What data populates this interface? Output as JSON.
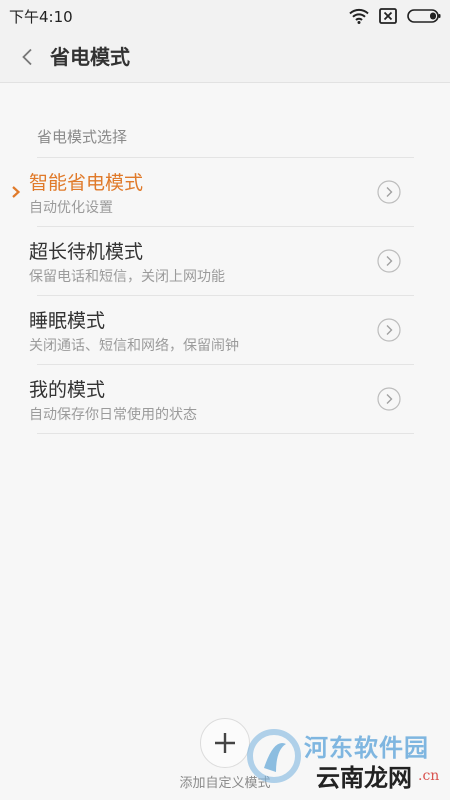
{
  "status_bar": {
    "time": "下午4:10",
    "icons": [
      "wifi-icon",
      "sim-missing-icon",
      "battery-icon"
    ]
  },
  "header": {
    "back_icon": "chevron-left-icon",
    "title": "省电模式"
  },
  "section": {
    "title": "省电模式选择"
  },
  "modes": [
    {
      "title": "智能省电模式",
      "description": "自动优化设置",
      "selected": true
    },
    {
      "title": "超长待机模式",
      "description": "保留电话和短信，关闭上网功能",
      "selected": false
    },
    {
      "title": "睡眠模式",
      "description": "关闭通话、短信和网络，保留闹钟",
      "selected": false
    },
    {
      "title": "我的模式",
      "description": "自动保存你日常使用的状态",
      "selected": false
    }
  ],
  "add_custom": {
    "icon": "plus-icon",
    "label": "添加自定义模式"
  },
  "watermark": {
    "top_text": "河东软件园",
    "bottom_text": "云南龙网",
    "domain": ".cn"
  },
  "colors": {
    "accent": "#e07a2a",
    "background": "#f7f7f7",
    "watermark_blue": "#7fb6e0"
  }
}
